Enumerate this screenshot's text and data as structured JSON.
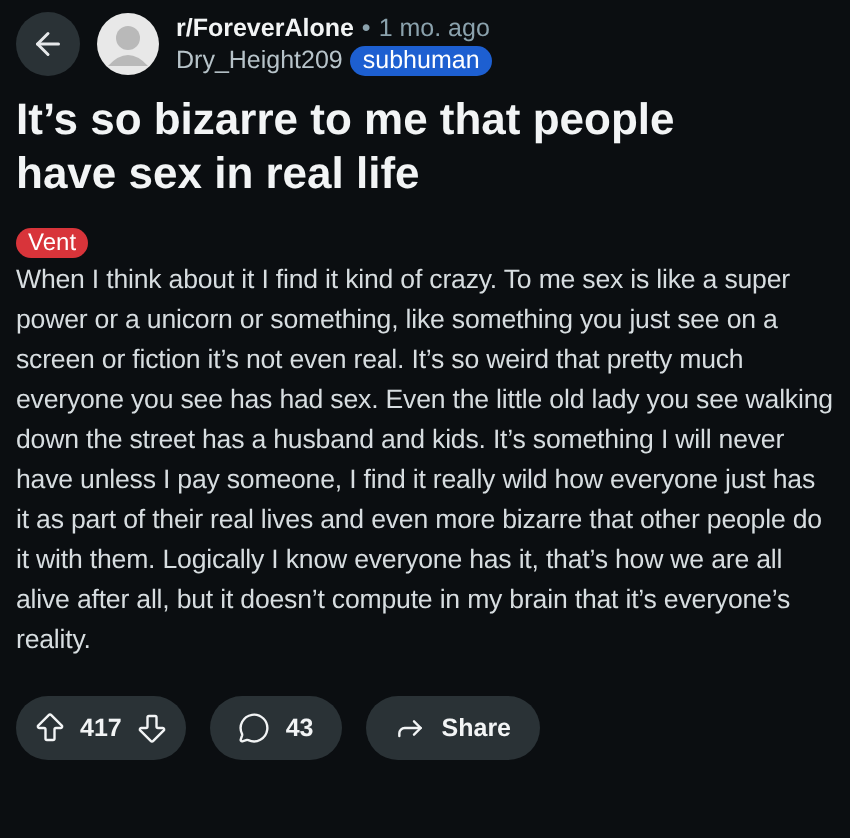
{
  "header": {
    "subreddit": "r/ForeverAlone",
    "separator": "•",
    "time": "1 mo. ago",
    "author": "Dry_Height209",
    "user_flair": {
      "text": "subhuman",
      "color": "#1d5fd1"
    }
  },
  "post": {
    "title": "It’s so bizarre to me that people have sex in real life",
    "flair": {
      "text": "Vent",
      "color": "#d8343a"
    },
    "body": "When I think about it I find it kind of crazy. To me sex is like a super power or a unicorn or something, like something you just see on a screen or fiction it’s not even real. It’s so weird that pretty much everyone you see has had sex. Even the little old lady you see walking down the street has a husband and kids. It’s something I will never have unless I pay someone, I find it really wild how everyone just has it as part of their real lives and even more bizarre that other people do it with them. Logically I know everyone has it, that’s how we are all alive after all, but it doesn’t compute in my brain that it’s everyone’s reality."
  },
  "actions": {
    "votes": "417",
    "comments": "43",
    "share": "Share"
  }
}
